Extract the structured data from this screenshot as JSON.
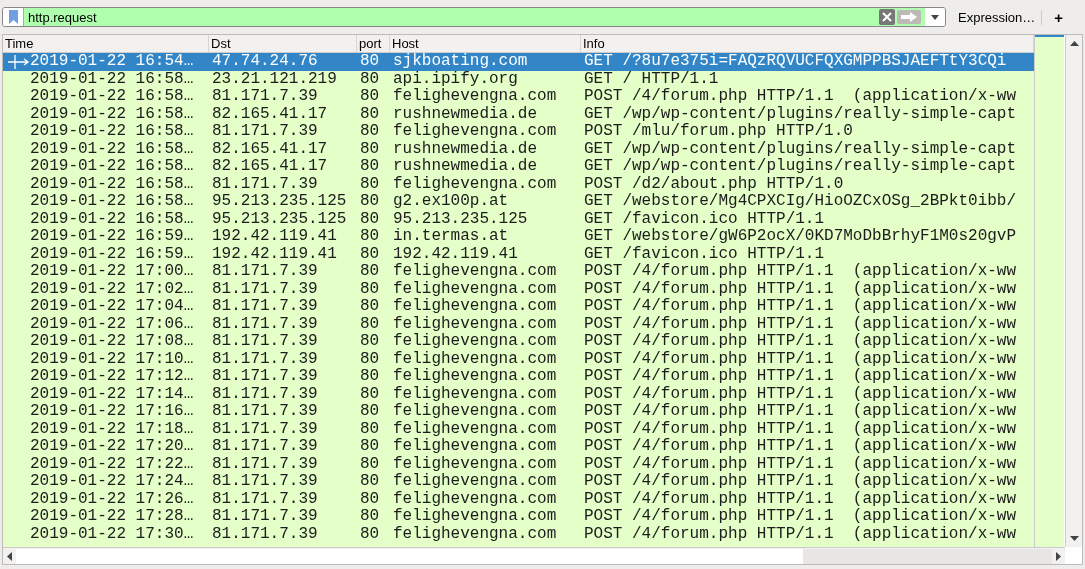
{
  "filter": {
    "value": "http.request"
  },
  "expression_button": "Expression…",
  "add_button": "+",
  "columns": [
    "Time",
    "Dst",
    "port",
    "Host",
    "Info"
  ],
  "rows": [
    {
      "time": "2019-01-22 16:54…",
      "dst": "47.74.24.76",
      "port": "80",
      "host": "sjkboating.com",
      "info": "GET /?8u7e375i=FAQzRQVUCFQXGMPPBSJAEFTtY3CQi",
      "selected": true
    },
    {
      "time": "2019-01-22 16:58…",
      "dst": "23.21.121.219",
      "port": "80",
      "host": "api.ipify.org",
      "info": "GET / HTTP/1.1",
      "selected": false
    },
    {
      "time": "2019-01-22 16:58…",
      "dst": "81.171.7.39",
      "port": "80",
      "host": "felighevengna.com",
      "info": "POST /4/forum.php HTTP/1.1  (application/x-ww",
      "selected": false
    },
    {
      "time": "2019-01-22 16:58…",
      "dst": "82.165.41.17",
      "port": "80",
      "host": "rushnewmedia.de",
      "info": "GET /wp/wp-content/plugins/really-simple-capt",
      "selected": false
    },
    {
      "time": "2019-01-22 16:58…",
      "dst": "81.171.7.39",
      "port": "80",
      "host": "felighevengna.com",
      "info": "POST /mlu/forum.php HTTP/1.0",
      "selected": false
    },
    {
      "time": "2019-01-22 16:58…",
      "dst": "82.165.41.17",
      "port": "80",
      "host": "rushnewmedia.de",
      "info": "GET /wp/wp-content/plugins/really-simple-capt",
      "selected": false
    },
    {
      "time": "2019-01-22 16:58…",
      "dst": "82.165.41.17",
      "port": "80",
      "host": "rushnewmedia.de",
      "info": "GET /wp/wp-content/plugins/really-simple-capt",
      "selected": false
    },
    {
      "time": "2019-01-22 16:58…",
      "dst": "81.171.7.39",
      "port": "80",
      "host": "felighevengna.com",
      "info": "POST /d2/about.php HTTP/1.0",
      "selected": false
    },
    {
      "time": "2019-01-22 16:58…",
      "dst": "95.213.235.125",
      "port": "80",
      "host": "g2.ex100p.at",
      "info": "GET /webstore/Mg4CPXCIg/HioOZCxOSg_2BPkt0ibb/",
      "selected": false
    },
    {
      "time": "2019-01-22 16:58…",
      "dst": "95.213.235.125",
      "port": "80",
      "host": "95.213.235.125",
      "info": "GET /favicon.ico HTTP/1.1",
      "selected": false
    },
    {
      "time": "2019-01-22 16:59…",
      "dst": "192.42.119.41",
      "port": "80",
      "host": "in.termas.at",
      "info": "GET /webstore/gW6P2ocX/0KD7MoDbBrhyF1M0s20gvP",
      "selected": false
    },
    {
      "time": "2019-01-22 16:59…",
      "dst": "192.42.119.41",
      "port": "80",
      "host": "192.42.119.41",
      "info": "GET /favicon.ico HTTP/1.1",
      "selected": false
    },
    {
      "time": "2019-01-22 17:00…",
      "dst": "81.171.7.39",
      "port": "80",
      "host": "felighevengna.com",
      "info": "POST /4/forum.php HTTP/1.1  (application/x-ww",
      "selected": false
    },
    {
      "time": "2019-01-22 17:02…",
      "dst": "81.171.7.39",
      "port": "80",
      "host": "felighevengna.com",
      "info": "POST /4/forum.php HTTP/1.1  (application/x-ww",
      "selected": false
    },
    {
      "time": "2019-01-22 17:04…",
      "dst": "81.171.7.39",
      "port": "80",
      "host": "felighevengna.com",
      "info": "POST /4/forum.php HTTP/1.1  (application/x-ww",
      "selected": false
    },
    {
      "time": "2019-01-22 17:06…",
      "dst": "81.171.7.39",
      "port": "80",
      "host": "felighevengna.com",
      "info": "POST /4/forum.php HTTP/1.1  (application/x-ww",
      "selected": false
    },
    {
      "time": "2019-01-22 17:08…",
      "dst": "81.171.7.39",
      "port": "80",
      "host": "felighevengna.com",
      "info": "POST /4/forum.php HTTP/1.1  (application/x-ww",
      "selected": false
    },
    {
      "time": "2019-01-22 17:10…",
      "dst": "81.171.7.39",
      "port": "80",
      "host": "felighevengna.com",
      "info": "POST /4/forum.php HTTP/1.1  (application/x-ww",
      "selected": false
    },
    {
      "time": "2019-01-22 17:12…",
      "dst": "81.171.7.39",
      "port": "80",
      "host": "felighevengna.com",
      "info": "POST /4/forum.php HTTP/1.1  (application/x-ww",
      "selected": false
    },
    {
      "time": "2019-01-22 17:14…",
      "dst": "81.171.7.39",
      "port": "80",
      "host": "felighevengna.com",
      "info": "POST /4/forum.php HTTP/1.1  (application/x-ww",
      "selected": false
    },
    {
      "time": "2019-01-22 17:16…",
      "dst": "81.171.7.39",
      "port": "80",
      "host": "felighevengna.com",
      "info": "POST /4/forum.php HTTP/1.1  (application/x-ww",
      "selected": false
    },
    {
      "time": "2019-01-22 17:18…",
      "dst": "81.171.7.39",
      "port": "80",
      "host": "felighevengna.com",
      "info": "POST /4/forum.php HTTP/1.1  (application/x-ww",
      "selected": false
    },
    {
      "time": "2019-01-22 17:20…",
      "dst": "81.171.7.39",
      "port": "80",
      "host": "felighevengna.com",
      "info": "POST /4/forum.php HTTP/1.1  (application/x-ww",
      "selected": false
    },
    {
      "time": "2019-01-22 17:22…",
      "dst": "81.171.7.39",
      "port": "80",
      "host": "felighevengna.com",
      "info": "POST /4/forum.php HTTP/1.1  (application/x-ww",
      "selected": false
    },
    {
      "time": "2019-01-22 17:24…",
      "dst": "81.171.7.39",
      "port": "80",
      "host": "felighevengna.com",
      "info": "POST /4/forum.php HTTP/1.1  (application/x-ww",
      "selected": false
    },
    {
      "time": "2019-01-22 17:26…",
      "dst": "81.171.7.39",
      "port": "80",
      "host": "felighevengna.com",
      "info": "POST /4/forum.php HTTP/1.1  (application/x-ww",
      "selected": false
    },
    {
      "time": "2019-01-22 17:28…",
      "dst": "81.171.7.39",
      "port": "80",
      "host": "felighevengna.com",
      "info": "POST /4/forum.php HTTP/1.1  (application/x-ww",
      "selected": false
    },
    {
      "time": "2019-01-22 17:30…",
      "dst": "81.171.7.39",
      "port": "80",
      "host": "felighevengna.com",
      "info": "POST /4/forum.php HTTP/1.1  (application/x-ww",
      "selected": false
    }
  ]
}
